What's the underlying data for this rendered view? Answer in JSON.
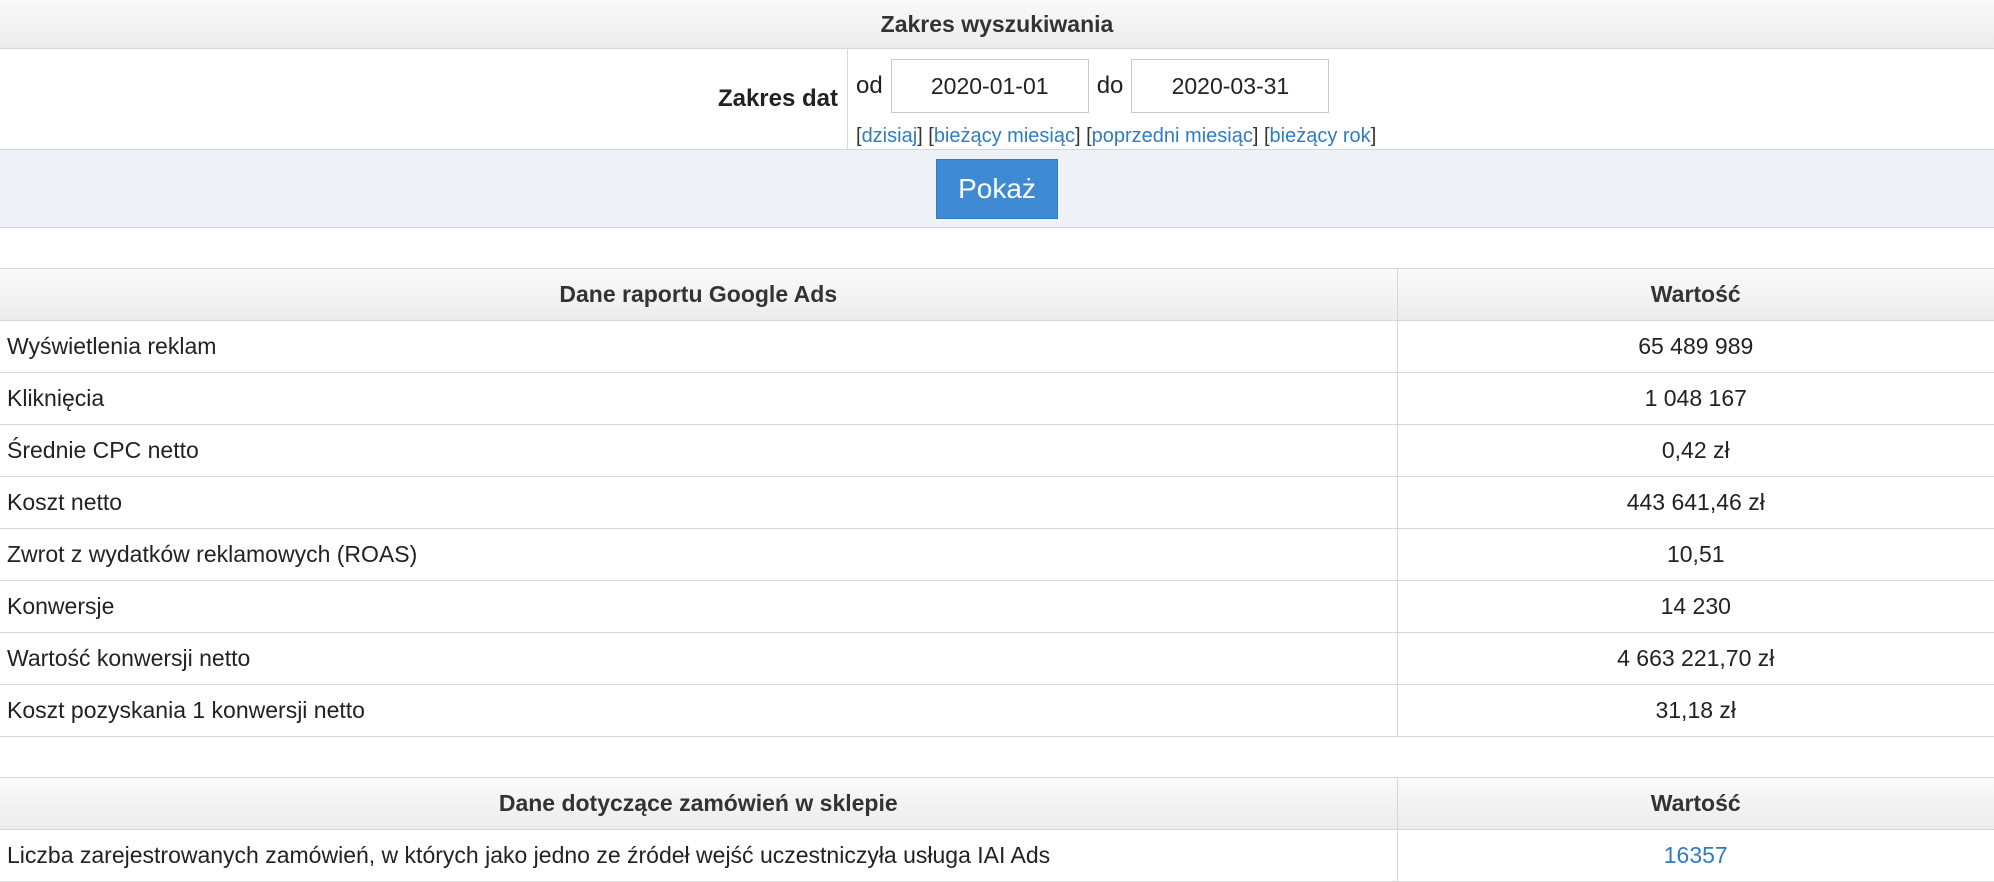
{
  "search": {
    "title": "Zakres wyszukiwania",
    "date_label": "Zakres dat",
    "from_word": "od",
    "from_value": "2020-01-01",
    "to_word": "do",
    "to_value": "2020-03-31",
    "quick_links": [
      "dzisiaj",
      "bieżący miesiąc",
      "poprzedni miesiąc",
      "bieżący rok"
    ],
    "show_button": "Pokaż"
  },
  "google_ads": {
    "header_name": "Dane raportu Google Ads",
    "header_value": "Wartość",
    "rows": [
      {
        "name": "Wyświetlenia reklam",
        "value": "65 489 989"
      },
      {
        "name": "Kliknięcia",
        "value": "1 048 167"
      },
      {
        "name": "Średnie CPC netto",
        "value": "0,42 zł"
      },
      {
        "name": "Koszt netto",
        "value": "443 641,46 zł"
      },
      {
        "name": "Zwrot z wydatków reklamowych (ROAS)",
        "value": "10,51"
      },
      {
        "name": "Konwersje",
        "value": "14 230"
      },
      {
        "name": "Wartość konwersji netto",
        "value": "4 663 221,70 zł"
      },
      {
        "name": "Koszt pozyskania 1 konwersji netto",
        "value": "31,18 zł"
      }
    ]
  },
  "shop_orders": {
    "header_name": "Dane dotyczące zamówień w sklepie",
    "header_value": "Wartość",
    "rows": [
      {
        "name": "Liczba zarejestrowanych zamówień, w których jako jedno ze źródeł wejść uczestniczyła usługa IAI Ads",
        "value": "16357"
      }
    ]
  },
  "colors": {
    "accent": "#3e8ad4",
    "link": "#2f7cc2",
    "header_bg": "#f2f2f2",
    "button_row_bg": "#eef2f7"
  }
}
